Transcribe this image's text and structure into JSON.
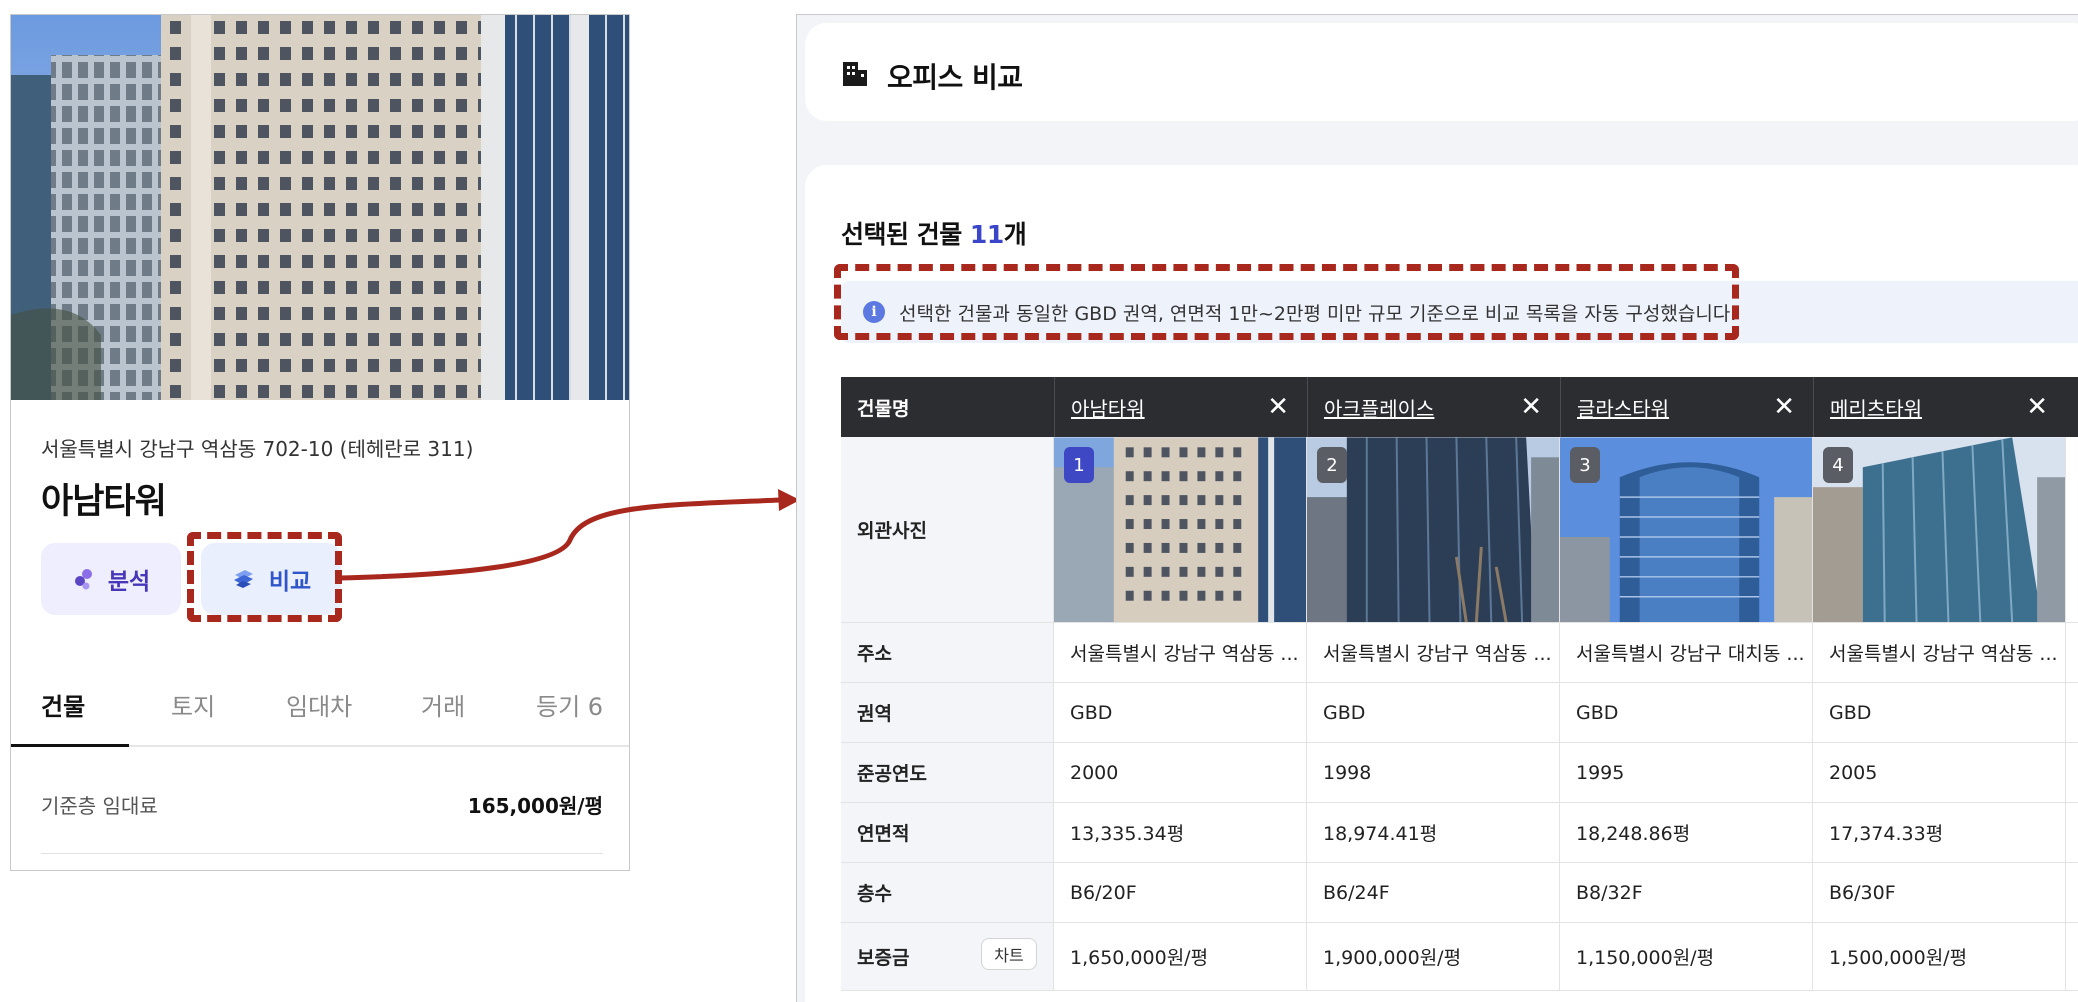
{
  "building_card": {
    "address": "서울특별시 강남구 역삼동 702-10 (테헤란로 311)",
    "name": "아남타워",
    "analyze_label": "분석",
    "compare_label": "비교",
    "tabs": [
      "건물",
      "토지",
      "임대차",
      "거래",
      "등기 6"
    ],
    "active_tab": "건물",
    "info": [
      {
        "label": "기준층 임대료",
        "value": "165,000원/평"
      }
    ]
  },
  "compare_panel": {
    "title": "오피스 비교",
    "selected_prefix": "선택된 건물 ",
    "selected_count": "11",
    "selected_suffix": "개",
    "notice_icon": "i",
    "notice": "선택한 건물과 동일한 GBD 권역, 연면적 1만~2만평 미만 규모 기준으로 비교 목록을 자동 구성했습니다.",
    "header_label": "건물명",
    "columns": [
      {
        "name": "아남타워",
        "badge": "1"
      },
      {
        "name": "아크플레이스",
        "badge": "2"
      },
      {
        "name": "글라스타워",
        "badge": "3"
      },
      {
        "name": "메리츠타워",
        "badge": "4"
      }
    ],
    "close_glyph": "✕",
    "rows": {
      "photo_label": "외관사진",
      "address_label": "주소",
      "address": [
        "서울특별시 강남구 역삼동 ...",
        "서울특별시 강남구 역삼동 ...",
        "서울특별시 강남구 대치동 ...",
        "서울특별시 강남구 역삼동 ..."
      ],
      "zone_label": "권역",
      "zone": [
        "GBD",
        "GBD",
        "GBD",
        "GBD"
      ],
      "year_label": "준공연도",
      "year": [
        "2000",
        "1998",
        "1995",
        "2005"
      ],
      "area_label": "연면적",
      "area": [
        "13,335.34평",
        "18,974.41평",
        "18,248.86평",
        "17,374.33평"
      ],
      "floors_label": "층수",
      "floors": [
        "B6/20F",
        "B6/24F",
        "B8/32F",
        "B6/30F"
      ],
      "deposit_label": "보증금",
      "chart_btn": "차트",
      "deposit": [
        "1,650,000원/평",
        "1,900,000원/평",
        "1,150,000원/평",
        "1,500,000원/평"
      ]
    }
  },
  "colors": {
    "annotation": "#a8281e",
    "accent": "#3b45c7",
    "table_header": "#2b2d31"
  }
}
